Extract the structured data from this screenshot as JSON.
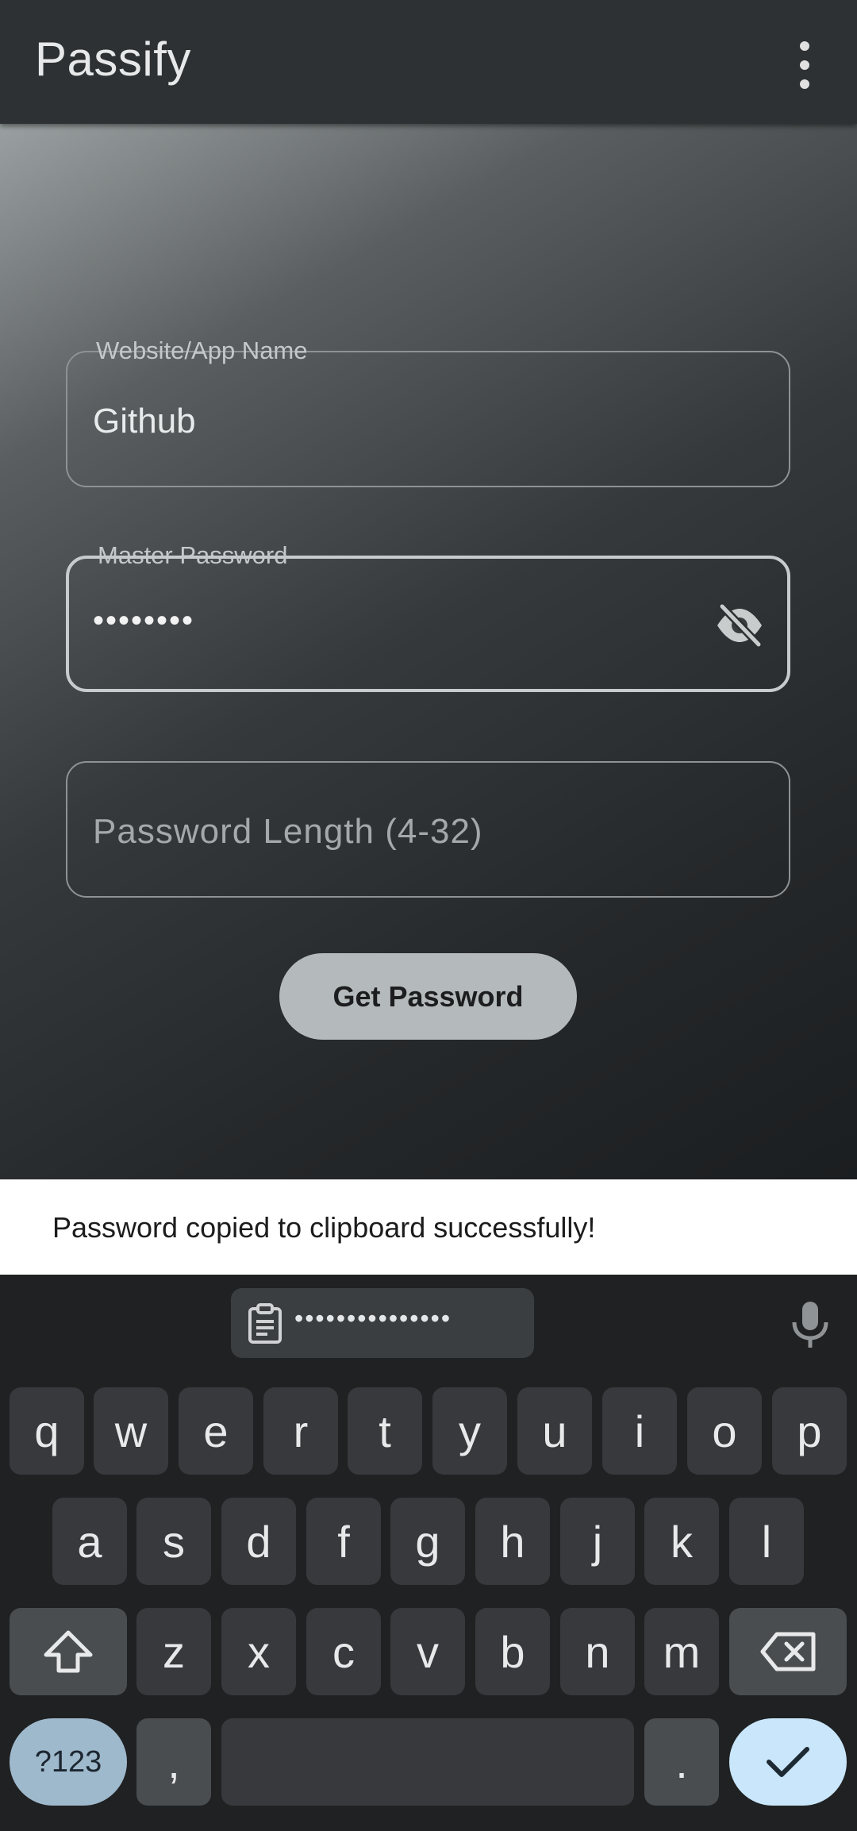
{
  "app": {
    "title": "Passify"
  },
  "form": {
    "website": {
      "label": "Website/App Name",
      "value": "Github"
    },
    "master": {
      "label": "Master Password",
      "value": "••••••••"
    },
    "length": {
      "placeholder": "Password Length (4-32)"
    },
    "button_label": "Get Password"
  },
  "snackbar": {
    "message": "Password copied to clipboard successfully!"
  },
  "keyboard": {
    "clipboard_preview": "•••••••••••••••",
    "row1": [
      "q",
      "w",
      "e",
      "r",
      "t",
      "y",
      "u",
      "i",
      "o",
      "p"
    ],
    "row2": [
      "a",
      "s",
      "d",
      "f",
      "g",
      "h",
      "j",
      "k",
      "l"
    ],
    "row3": [
      "z",
      "x",
      "c",
      "v",
      "b",
      "n",
      "m"
    ],
    "symbols_key": "?123",
    "comma_key": ",",
    "period_key": "."
  },
  "colors": {
    "appbar": "#2e3133",
    "button": "#b4b9bc",
    "enter_key": "#c9e6fb",
    "symbols_key": "#9fb9cc"
  }
}
